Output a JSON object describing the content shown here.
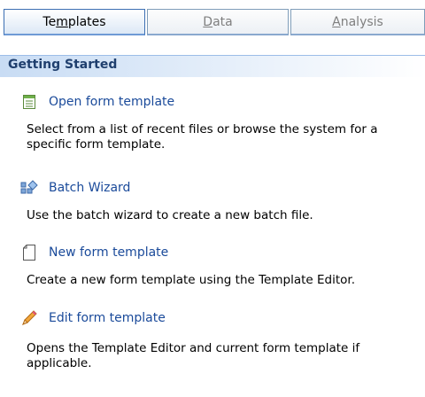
{
  "tabs": [
    {
      "label_pre": "Te",
      "label_ul": "m",
      "label_post": "plates"
    },
    {
      "label_pre": "",
      "label_ul": "D",
      "label_post": "ata"
    },
    {
      "label_pre": "",
      "label_ul": "A",
      "label_post": "nalysis"
    }
  ],
  "section": {
    "title": "Getting Started"
  },
  "items": [
    {
      "title": "Open form template",
      "icon": "form-list-icon",
      "description": "Select from a list of recent files or browse the system for a specific form template."
    },
    {
      "title": "Batch Wizard",
      "icon": "batch-wizard-icon",
      "description": "Use the batch wizard to create a new batch file."
    },
    {
      "title": "New form template",
      "icon": "blank-page-icon",
      "description": "Create a new form template using the Template Editor."
    },
    {
      "title": "Edit form template",
      "icon": "pencil-icon",
      "description": "Opens the Template Editor and current form template if applicable."
    }
  ],
  "colors": {
    "link": "#1a4a9a",
    "header_text": "#1f3f6e",
    "header_bg": "#c8dcf4"
  }
}
